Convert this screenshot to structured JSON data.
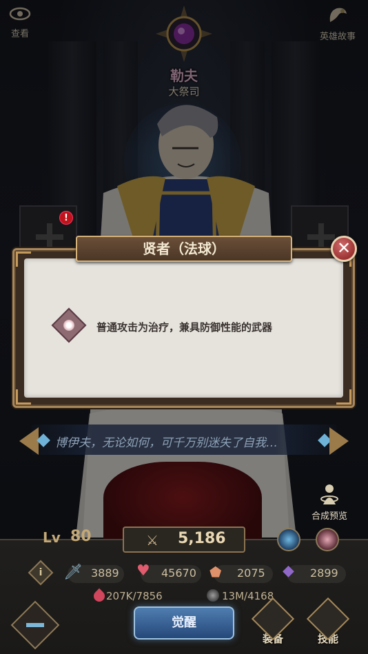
{
  "header": {
    "view_label": "查看",
    "story_label": "英雄故事",
    "hero_name": "勒夫",
    "hero_title": "大祭司"
  },
  "equip_slots": {
    "left_alert": "!"
  },
  "modal": {
    "title": "贤者（法球）",
    "close_glyph": "✕",
    "description": "普通攻击为治疗，兼具防御性能的武器"
  },
  "quote": {
    "text": "博伊夫，无论如何，可千万别迷失了自我…"
  },
  "compose": {
    "label": "合成预览"
  },
  "stats": {
    "level_label": "Lv",
    "level": "80",
    "power": "5,186",
    "attack": "3889",
    "hp": "45670",
    "defense": "2075",
    "magic": "2899",
    "resource_1": "207K/7856",
    "resource_2": "13M/4168"
  },
  "actions": {
    "awaken_label": "觉醒",
    "equip_label": "装备",
    "skill_label": "技能"
  },
  "colors": {
    "hero_name": "#e7b6d4",
    "modal_frame": "#a8875b",
    "close_button": "#9b3333",
    "awaken_button": "#26487a"
  },
  "icons": [
    "eye-icon",
    "story-icon",
    "emblem-icon",
    "plus-icon",
    "alert-icon",
    "close-icon",
    "orb-weapon-icon",
    "arrow-left-icon",
    "arrow-right-icon",
    "compose-icon",
    "crossed-swords-icon",
    "info-icon",
    "sword-icon",
    "heart-icon",
    "shield-icon",
    "crystal-icon",
    "blood-drop-icon",
    "coin-icon",
    "equip-icon",
    "skill-icon"
  ]
}
